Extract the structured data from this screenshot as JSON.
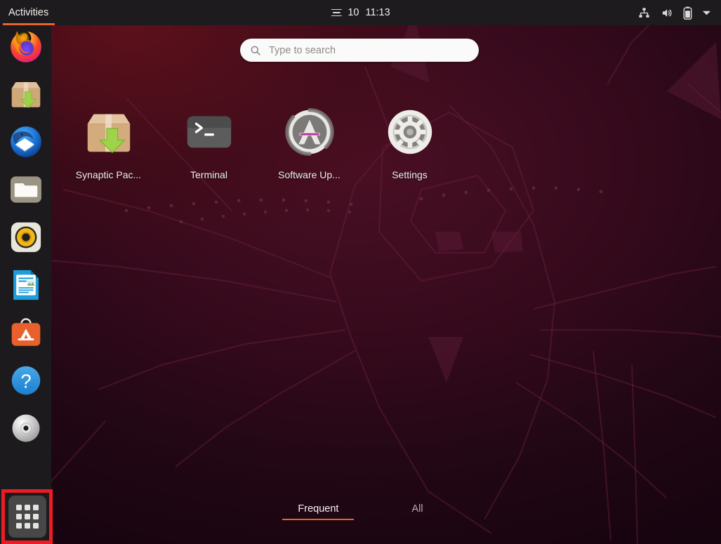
{
  "topbar": {
    "activities_label": "Activities",
    "clock": {
      "day": "10",
      "time": "11:13",
      "menu_icon": "agenda-icon"
    },
    "tray": {
      "network_icon": "network-wired-icon",
      "volume_icon": "volume-high-icon",
      "battery_icon": "battery-icon",
      "menu_icon": "chevron-down-icon"
    }
  },
  "search": {
    "placeholder": "Type to search",
    "value": "",
    "icon": "search-icon"
  },
  "dock": {
    "items": [
      {
        "name": "firefox",
        "label": "Firefox"
      },
      {
        "name": "synaptic",
        "label": "Synaptic Package Manager"
      },
      {
        "name": "thunderbird",
        "label": "Thunderbird Mail"
      },
      {
        "name": "files",
        "label": "Files"
      },
      {
        "name": "rhythmbox",
        "label": "Rhythmbox"
      },
      {
        "name": "libreoffice-writer",
        "label": "LibreOffice Writer"
      },
      {
        "name": "ubuntu-software",
        "label": "Ubuntu Software"
      },
      {
        "name": "help",
        "label": "Help"
      },
      {
        "name": "disc",
        "label": "Disc Image Mounter"
      }
    ],
    "show_applications": {
      "label": "Show Applications",
      "icon": "apps-grid-icon",
      "highlighted": true
    }
  },
  "apps": [
    {
      "caption": "Synaptic Pac...",
      "icon": "synaptic-icon"
    },
    {
      "caption": "Terminal",
      "icon": "terminal-icon"
    },
    {
      "caption": "Software Up...",
      "icon": "software-updater-icon"
    },
    {
      "caption": "Settings",
      "icon": "settings-gear-icon"
    }
  ],
  "tabs": [
    {
      "label": "Frequent",
      "active": true
    },
    {
      "label": "All",
      "active": false
    }
  ],
  "colors": {
    "accent_orange": "#e8622b",
    "highlight_red": "#ed1c24",
    "topbar_bg": "#1d1b1d",
    "dock_bg": "#1c1a1c",
    "wallpaper_dark": "#16040f",
    "wallpaper_light": "#4a0f24"
  }
}
